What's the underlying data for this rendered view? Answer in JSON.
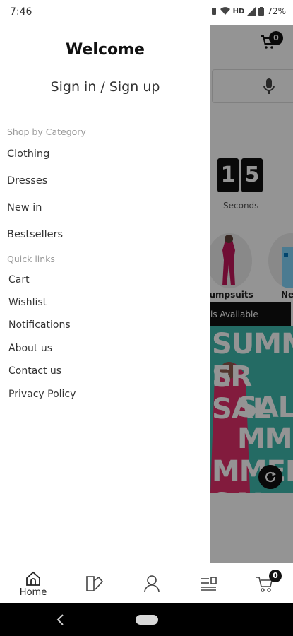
{
  "status_bar": {
    "time": "7:46",
    "network_label": "HD",
    "battery": "72%"
  },
  "background": {
    "cart_count": "0",
    "countdown_digits": [
      "1",
      "5"
    ],
    "countdown_label": "Seconds",
    "categories": [
      "Jumpsuits",
      "Ne"
    ],
    "banner_text": "is Available",
    "promo_lines": [
      "SUMMER S",
      "ER SAL",
      "SALE",
      "MMER",
      "MMER SAL"
    ]
  },
  "drawer": {
    "title": "Welcome",
    "sign_in_label": "Sign in / Sign up",
    "shop_section_label": "Shop by Category",
    "categories": [
      "Clothing",
      "Dresses",
      "New in",
      "Bestsellers"
    ],
    "quick_links_label": "Quick links",
    "quick_links": [
      "Cart",
      "Wishlist",
      "Notifications",
      "About us",
      "Contact us",
      "Privacy Policy"
    ]
  },
  "bottom_nav": {
    "home_label": "Home",
    "cart_count": "0"
  },
  "colors": {
    "promo_teal": "#3fb8ac",
    "promo_pink": "#e0306a",
    "badge_black": "#111111"
  }
}
